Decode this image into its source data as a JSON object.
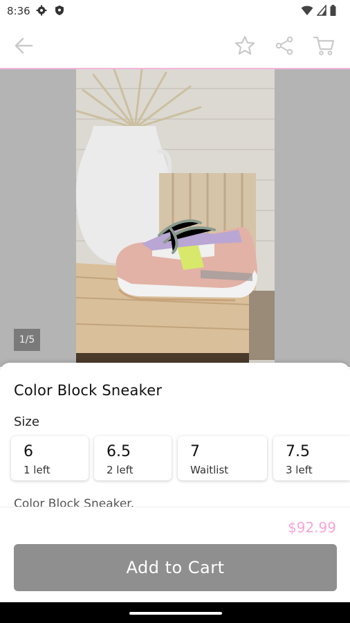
{
  "status_bar": {
    "time": "8:36"
  },
  "product": {
    "title": "Color Block Sneaker",
    "size_label": "Size",
    "sizes": [
      {
        "size": "6",
        "stock": "1 left"
      },
      {
        "size": "6.5",
        "stock": "2 left"
      },
      {
        "size": "7",
        "stock": "Waitlist"
      },
      {
        "size": "7.5",
        "stock": "3 left"
      }
    ],
    "description": "Color Block Sneaker.",
    "price": "$92.99",
    "add_to_cart": "Add to Cart"
  },
  "gallery": {
    "pager": "1/5"
  },
  "colors": {
    "accent_pink": "#f4b6dc",
    "price_pink": "#f3a6d8",
    "button_gray": "#8f8f8f"
  },
  "icons": [
    "back-arrow-icon",
    "star-icon",
    "share-icon",
    "cart-icon",
    "settings-icon",
    "shield-icon",
    "wifi-icon",
    "signal-icon",
    "battery-icon"
  ]
}
